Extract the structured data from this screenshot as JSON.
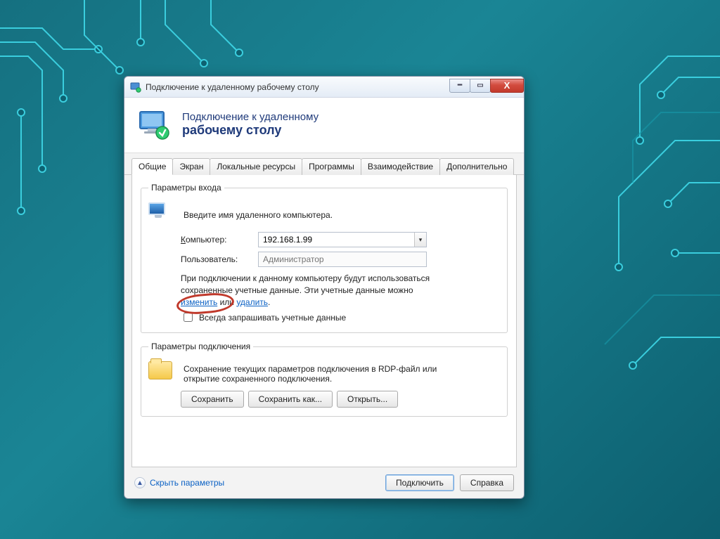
{
  "titlebar": {
    "title": "Подключение к удаленному рабочему столу"
  },
  "header": {
    "line1": "Подключение к удаленному",
    "line2": "рабочему столу"
  },
  "tabs": {
    "items": [
      {
        "label": "Общие"
      },
      {
        "label": "Экран"
      },
      {
        "label": "Локальные ресурсы"
      },
      {
        "label": "Программы"
      },
      {
        "label": "Взаимодействие"
      },
      {
        "label": "Дополнительно"
      }
    ]
  },
  "login": {
    "legend": "Параметры входа",
    "intro": "Введите имя удаленного компьютера.",
    "computer_label": "Компьютер:",
    "computer_value": "192.168.1.99",
    "user_label": "Пользователь:",
    "user_placeholder": "Администратор",
    "note_prefix": "При подключении к данному компьютеру будут использоваться сохраненные учетные данные. Эти учетные данные можно ",
    "note_link1": "изменить",
    "note_mid": " или ",
    "note_link2": "удалить",
    "note_suffix": ".",
    "checkbox_label": "Всегда запрашивать учетные данные"
  },
  "conn": {
    "legend": "Параметры подключения",
    "text": "Сохранение текущих параметров подключения в RDP-файл или открытие сохраненного подключения.",
    "save": "Сохранить",
    "save_as": "Сохранить как...",
    "open": "Открыть..."
  },
  "footer": {
    "hide": "Скрыть параметры",
    "connect": "Подключить",
    "help": "Справка"
  }
}
